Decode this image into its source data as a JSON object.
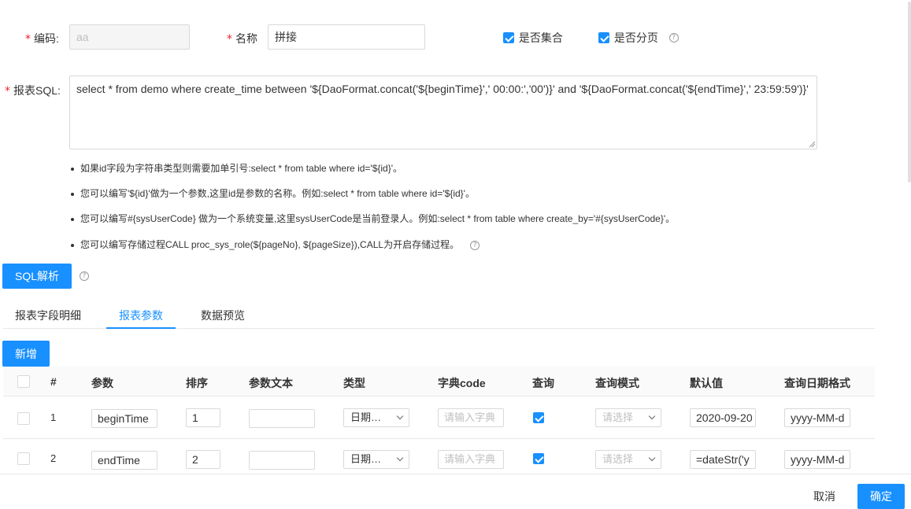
{
  "form": {
    "code_label": "编码:",
    "code_value": "aa",
    "name_label": "名称",
    "name_value": "拼接",
    "is_collection_label": "是否集合",
    "is_paged_label": "是否分页",
    "sql_label": "报表SQL:",
    "sql_value": "select * from demo where create_time between '${DaoFormat.concat('${beginTime}',' 00:00:','00')}' and '${DaoFormat.concat('${endTime}',' 23:59:59')}'"
  },
  "hints": [
    "如果id字段为字符串类型则需要加单引号:select * from table where id='${id}'。",
    "您可以编写'${id}'做为一个参数,这里id是参数的名称。例如:select * from table where id='${id}'。",
    "您可以编写#{sysUserCode} 做为一个系统变量,这里sysUserCode是当前登录人。例如:select * from table where create_by='#{sysUserCode}'。",
    "您可以编写存储过程CALL proc_sys_role(${pageNo}, ${pageSize}),CALL为开启存储过程。"
  ],
  "sql_parse_button": "SQL解析",
  "tabs": [
    "报表字段明细",
    "报表参数",
    "数据预览"
  ],
  "add_button": "新增",
  "table": {
    "headers": [
      "#",
      "参数",
      "排序",
      "参数文本",
      "类型",
      "字典code",
      "查询",
      "查询模式",
      "默认值",
      "查询日期格式"
    ],
    "rows": [
      {
        "index": "1",
        "param": "beginTime",
        "order": "1",
        "text": "",
        "type": "日期…",
        "dict_placeholder": "请输入字典",
        "query_checked": true,
        "mode_placeholder": "请选择",
        "default": "2020-09-20",
        "date_format": "yyyy-MM-d"
      },
      {
        "index": "2",
        "param": "endTime",
        "order": "2",
        "text": "",
        "type": "日期…",
        "dict_placeholder": "请输入字典",
        "query_checked": true,
        "mode_placeholder": "请选择",
        "default": "=dateStr('y",
        "date_format": "yyyy-MM-d"
      }
    ]
  },
  "footer": {
    "cancel": "取消",
    "ok": "确定"
  },
  "colors": {
    "primary": "#1890ff",
    "required": "#f5222d",
    "border": "#d9d9d9"
  }
}
